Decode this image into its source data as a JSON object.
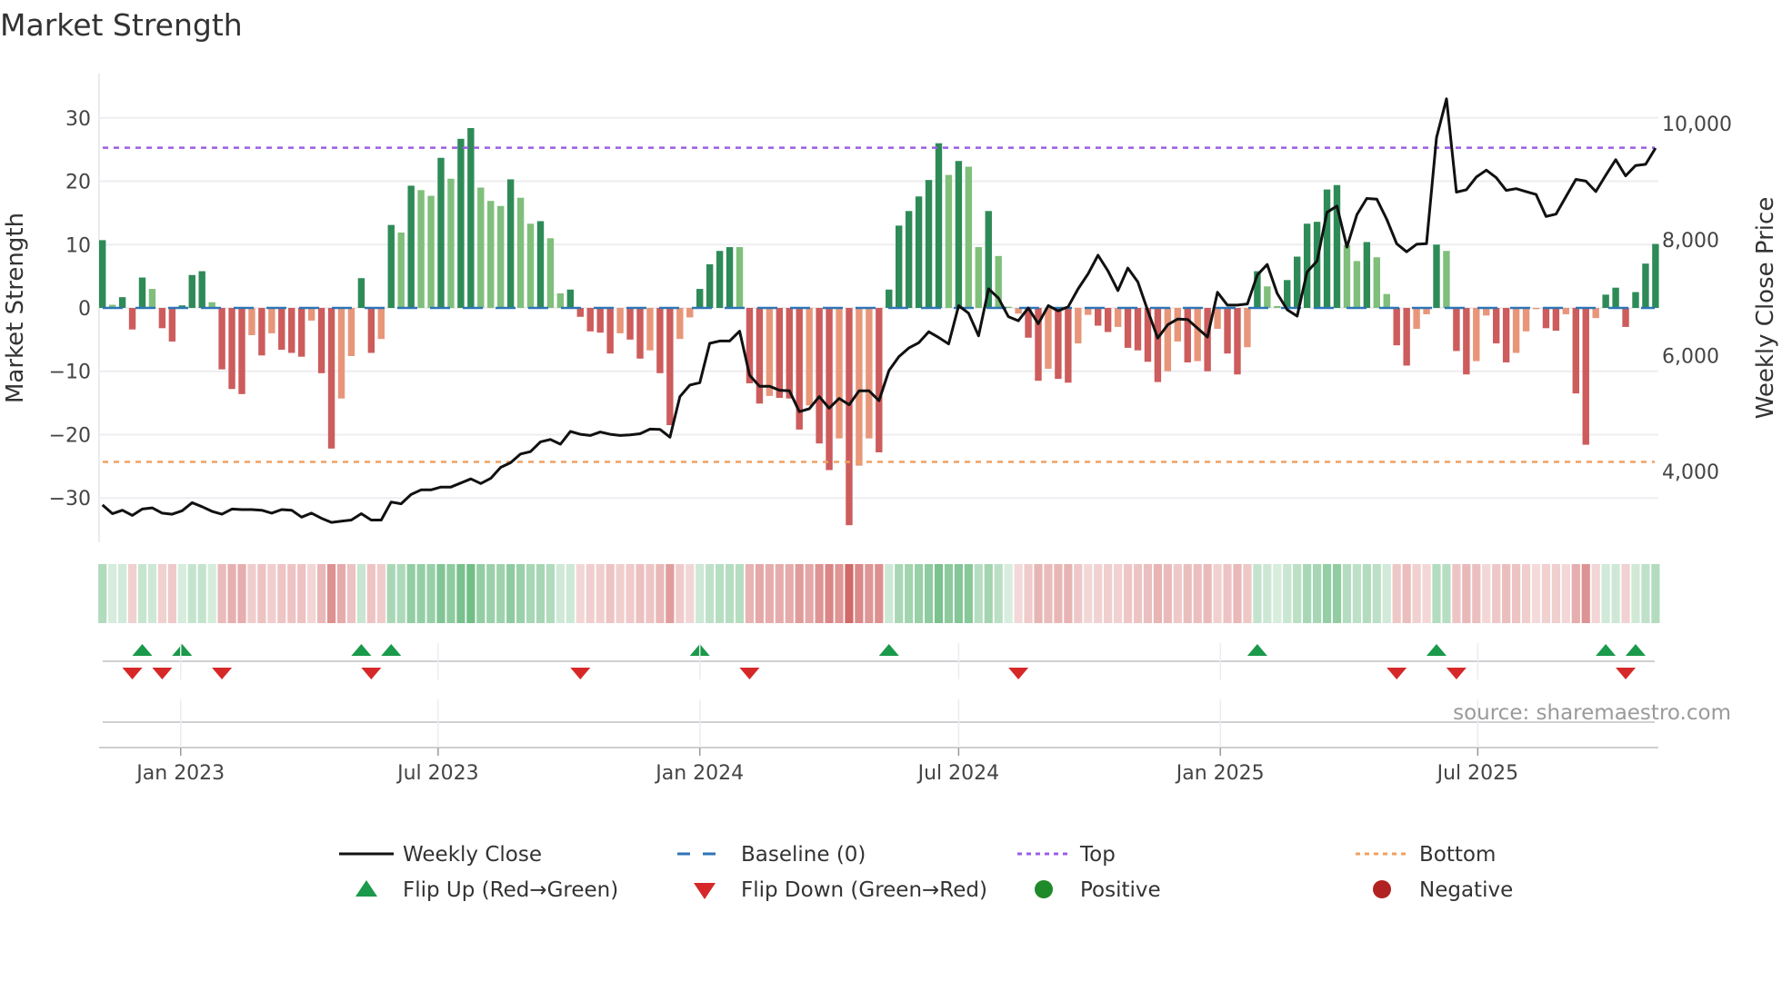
{
  "chart_data": {
    "type": "bar",
    "title": "Market Strength",
    "ylabel": "Market Strength",
    "ylabel_right": "Weekly Close Price",
    "ylim": [
      -37,
      37
    ],
    "ylim_right": [
      2776,
      10866
    ],
    "yticks": [
      30,
      20,
      10,
      0,
      -10,
      -20,
      -30
    ],
    "ytick_labels": [
      "30",
      "20",
      "10",
      "0",
      "−10",
      "−20",
      "−30"
    ],
    "yticks_right": [
      10000,
      8000,
      6000,
      4000
    ],
    "ytick_labels_right": [
      "10,000",
      "8,000",
      "6,000",
      "4,000"
    ],
    "x_start": "2022-11-07",
    "x_frequency": "weekly",
    "xticks": [
      {
        "date": "2023-01-01",
        "label": "Jan 2023"
      },
      {
        "date": "2023-07-01",
        "label": "Jul 2023"
      },
      {
        "date": "2024-01-01",
        "label": "Jan 2024"
      },
      {
        "date": "2024-07-01",
        "label": "Jul 2024"
      },
      {
        "date": "2025-01-01",
        "label": "Jan 2025"
      },
      {
        "date": "2025-07-01",
        "label": "Jul 2025"
      }
    ],
    "grid": true,
    "levels": {
      "top": 25.3,
      "bottom": -24.3,
      "baseline": 0
    },
    "strength": [
      10.7,
      0.5,
      1.7,
      -3.4,
      4.8,
      3.0,
      -3.2,
      -5.3,
      0.4,
      5.2,
      5.8,
      0.9,
      -9.7,
      -12.8,
      -13.6,
      -4.3,
      -7.5,
      -4.0,
      -6.6,
      -7.1,
      -7.7,
      -2.0,
      -10.3,
      -22.2,
      -14.3,
      -7.6,
      4.7,
      -7.1,
      -4.9,
      13.1,
      11.9,
      19.3,
      18.6,
      17.7,
      23.7,
      20.4,
      26.7,
      28.4,
      19.0,
      16.9,
      16.1,
      20.3,
      17.4,
      13.3,
      13.7,
      11.0,
      2.3,
      2.9,
      -1.4,
      -3.7,
      -3.9,
      -7.2,
      -4.0,
      -5.0,
      -8.0,
      -6.7,
      -10.3,
      -18.5,
      -4.9,
      -1.5,
      3.0,
      6.9,
      9.0,
      9.6,
      9.6,
      -11.9,
      -15.1,
      -13.9,
      -14.2,
      -14.3,
      -19.2,
      -15.4,
      -21.4,
      -25.6,
      -20.6,
      -34.3,
      -24.9,
      -20.6,
      -22.8,
      2.9,
      13.0,
      15.3,
      17.6,
      20.2,
      26.0,
      21.0,
      23.2,
      22.3,
      9.6,
      15.3,
      8.2,
      0.2,
      -0.9,
      -4.7,
      -11.5,
      -9.6,
      -11.2,
      -11.8,
      -5.6,
      -1.1,
      -2.8,
      -3.8,
      -3.0,
      -6.3,
      -6.7,
      -8.5,
      -11.7,
      -10.0,
      -5.3,
      -8.6,
      -8.4,
      -10.0,
      -3.3,
      -7.2,
      -10.5,
      -6.2,
      5.8,
      3.4,
      0.3,
      4.4,
      8.1,
      13.3,
      13.6,
      18.7,
      19.4,
      9.9,
      7.4,
      10.4,
      8.0,
      2.2,
      -5.9,
      -9.1,
      -3.3,
      -1.0,
      10.0,
      9.0,
      -6.8,
      -10.5,
      -8.4,
      -1.2,
      -5.6,
      -8.6,
      -7.1,
      -3.7,
      -0.2,
      -3.2,
      -3.6,
      -1.0,
      -13.5,
      -21.6,
      -1.6,
      2.1,
      3.2,
      -3.0,
      2.5,
      7.0,
      10.1
    ],
    "shade": [
      "D",
      "L",
      "D",
      "R",
      "D",
      "L",
      "R",
      "R",
      "D",
      "D",
      "D",
      "L",
      "R",
      "R",
      "R",
      "O",
      "R",
      "O",
      "R",
      "R",
      "R",
      "O",
      "R",
      "R",
      "O",
      "O",
      "D",
      "R",
      "O",
      "D",
      "L",
      "D",
      "L",
      "L",
      "D",
      "L",
      "D",
      "D",
      "L",
      "L",
      "L",
      "D",
      "L",
      "L",
      "D",
      "L",
      "L",
      "D",
      "R",
      "R",
      "R",
      "R",
      "O",
      "R",
      "R",
      "O",
      "R",
      "R",
      "O",
      "O",
      "D",
      "D",
      "D",
      "D",
      "L",
      "R",
      "R",
      "O",
      "R",
      "R",
      "R",
      "O",
      "R",
      "R",
      "O",
      "R",
      "O",
      "O",
      "R",
      "D",
      "D",
      "D",
      "D",
      "D",
      "D",
      "L",
      "D",
      "L",
      "L",
      "D",
      "L",
      "L",
      "O",
      "R",
      "R",
      "O",
      "R",
      "R",
      "O",
      "O",
      "R",
      "R",
      "O",
      "R",
      "R",
      "R",
      "R",
      "O",
      "O",
      "R",
      "O",
      "R",
      "O",
      "R",
      "R",
      "O",
      "D",
      "L",
      "L",
      "D",
      "D",
      "D",
      "D",
      "D",
      "D",
      "L",
      "L",
      "D",
      "L",
      "L",
      "R",
      "R",
      "O",
      "O",
      "D",
      "L",
      "R",
      "R",
      "O",
      "O",
      "R",
      "R",
      "O",
      "O",
      "O",
      "R",
      "R",
      "O",
      "R",
      "R",
      "O",
      "D",
      "D",
      "R",
      "D",
      "D",
      "D"
    ],
    "weekly_close": [
      3420,
      3270,
      3330,
      3240,
      3350,
      3370,
      3280,
      3260,
      3320,
      3460,
      3390,
      3310,
      3260,
      3350,
      3340,
      3340,
      3330,
      3280,
      3340,
      3330,
      3210,
      3280,
      3190,
      3120,
      3140,
      3160,
      3270,
      3160,
      3160,
      3470,
      3440,
      3600,
      3680,
      3680,
      3730,
      3730,
      3800,
      3870,
      3790,
      3880,
      4070,
      4150,
      4300,
      4340,
      4510,
      4550,
      4470,
      4690,
      4640,
      4620,
      4680,
      4640,
      4620,
      4630,
      4650,
      4730,
      4725,
      4590,
      5290,
      5490,
      5530,
      6210,
      6250,
      6250,
      6420,
      5660,
      5470,
      5470,
      5400,
      5390,
      5030,
      5080,
      5290,
      5090,
      5260,
      5150,
      5390,
      5390,
      5220,
      5740,
      5980,
      6130,
      6220,
      6410,
      6310,
      6200,
      6860,
      6730,
      6340,
      7150,
      6990,
      6670,
      6600,
      6820,
      6550,
      6860,
      6770,
      6840,
      7150,
      7410,
      7730,
      7460,
      7120,
      7510,
      7270,
      6770,
      6300,
      6530,
      6630,
      6620,
      6470,
      6320,
      7090,
      6870,
      6870,
      6890,
      7390,
      7570,
      7070,
      6790,
      6680,
      7440,
      7630,
      8470,
      8580,
      7870,
      8430,
      8710,
      8700,
      8350,
      7930,
      7790,
      7920,
      7930,
      9760,
      10430,
      8820,
      8860,
      9080,
      9200,
      9070,
      8850,
      8880,
      8830,
      8780,
      8400,
      8440,
      8740,
      9040,
      9010,
      8830,
      9110,
      9380,
      9100,
      9280,
      9300,
      9580
    ],
    "flip_up_weeks": [
      4,
      8,
      26,
      29,
      60,
      79,
      116,
      134,
      151,
      154
    ],
    "flip_down_weeks": [
      3,
      6,
      12,
      27,
      48,
      65,
      92,
      130,
      136,
      153
    ],
    "legend": {
      "placement": "bottom",
      "items": [
        {
          "key": "weekly_close",
          "label": "Weekly Close"
        },
        {
          "key": "baseline",
          "label": "Baseline (0)"
        },
        {
          "key": "top",
          "label": "Top"
        },
        {
          "key": "bottom",
          "label": "Bottom"
        },
        {
          "key": "flip_up",
          "label": "Flip Up (Red→Green)"
        },
        {
          "key": "flip_down",
          "label": "Flip Down (Green→Red)"
        },
        {
          "key": "positive",
          "label": "Positive"
        },
        {
          "key": "negative",
          "label": "Negative"
        }
      ]
    },
    "annotation": "source: sharemaestro.com",
    "colors": {
      "dark_green": "#2e8b57",
      "light_green": "#7fbf7b",
      "red": "#cd5c5c",
      "salmon": "#e8967a",
      "price_line": "#111111",
      "baseline": "#2e75b6",
      "top": "#9b5de5",
      "bottom": "#f0a060",
      "flip_up": "#1a9a4a",
      "flip_down": "#d62828",
      "positive": "#1f8a2a",
      "negative": "#b22222"
    }
  }
}
